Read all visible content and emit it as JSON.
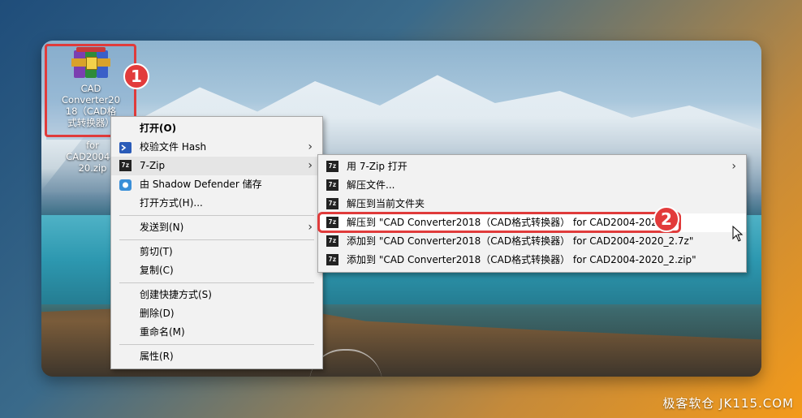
{
  "desktop_icon": {
    "label_lines": [
      "CAD",
      "Converter20",
      "18（CAD格",
      "式转换器）"
    ],
    "overflow_lines": [
      "for",
      "CAD2004-2",
      "20.zip"
    ],
    "icon": "winrar-archive-icon"
  },
  "annotations": {
    "badge1": "1",
    "badge2": "2"
  },
  "context_menu": {
    "items": [
      {
        "label": "打开(O)",
        "bold": true,
        "icon": ""
      },
      {
        "label": "校验文件 Hash",
        "icon": "powershell-icon",
        "submenu": true
      },
      {
        "label": "7-Zip",
        "icon": "7zip-icon",
        "submenu": true,
        "active": true
      },
      {
        "label": "由 Shadow Defender 储存",
        "icon": "shadow-defender-icon"
      },
      {
        "label": "打开方式(H)...",
        "icon": ""
      },
      {
        "label": "发送到(N)",
        "icon": "",
        "submenu": true
      },
      {
        "label": "剪切(T)",
        "icon": ""
      },
      {
        "label": "复制(C)",
        "icon": ""
      },
      {
        "label": "创建快捷方式(S)",
        "icon": ""
      },
      {
        "label": "删除(D)",
        "icon": ""
      },
      {
        "label": "重命名(M)",
        "icon": ""
      },
      {
        "label": "属性(R)",
        "icon": ""
      }
    ]
  },
  "zip_submenu": {
    "items": [
      {
        "label": "用 7-Zip 打开",
        "submenu": true
      },
      {
        "label": "解压文件..."
      },
      {
        "label": "解压到当前文件夹"
      },
      {
        "label": "解压到 \"CAD Converter2018（CAD格式转换器） for CAD2004-2020\\\"",
        "hover": true
      },
      {
        "label": "添加到 \"CAD Converter2018（CAD格式转换器） for CAD2004-2020_2.7z\""
      },
      {
        "label": "添加到 \"CAD Converter2018（CAD格式转换器） for CAD2004-2020_2.zip\""
      }
    ]
  },
  "watermark": "极客软仓 JK115.COM"
}
